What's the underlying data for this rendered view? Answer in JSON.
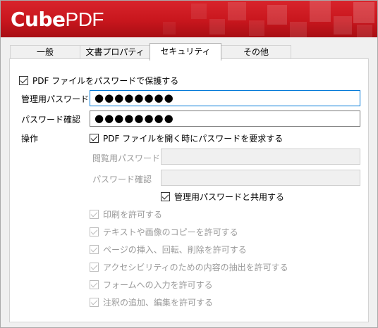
{
  "app": {
    "logo_bold": "Cube",
    "logo_light": "PDF"
  },
  "tabs": [
    {
      "label": "一般",
      "active": false
    },
    {
      "label": "文書プロパティ",
      "active": false
    },
    {
      "label": "セキュリティ",
      "active": true
    },
    {
      "label": "その他",
      "active": false
    }
  ],
  "security": {
    "protect_label": "PDF ファイルをパスワードで保護する",
    "protect_checked": true,
    "owner_password_label": "管理用パスワード",
    "owner_password_value": "●●●●●●●●",
    "owner_confirm_label": "パスワード確認",
    "owner_confirm_value": "●●●●●●●●",
    "operations_label": "操作",
    "require_open_label": "PDF ファイルを開く時にパスワードを要求する",
    "require_open_checked": true,
    "user_password_label": "閲覧用パスワード",
    "user_password_value": "",
    "user_confirm_label": "パスワード確認",
    "user_confirm_value": "",
    "share_label": "管理用パスワードと共用する",
    "share_checked": true,
    "permissions": [
      {
        "label": "印刷を許可する",
        "checked": true
      },
      {
        "label": "テキストや画像のコピーを許可する",
        "checked": true
      },
      {
        "label": "ページの挿入、回転、削除を許可する",
        "checked": true
      },
      {
        "label": "アクセシビリティのための内容の抽出を許可する",
        "checked": true
      },
      {
        "label": "フォームへの入力を許可する",
        "checked": true
      },
      {
        "label": "注釈の追加、編集を許可する",
        "checked": true
      }
    ]
  },
  "colors": {
    "banner_red": "#c8161d",
    "focus_blue": "#0078d7",
    "disabled_gray": "#9a9a9a"
  }
}
